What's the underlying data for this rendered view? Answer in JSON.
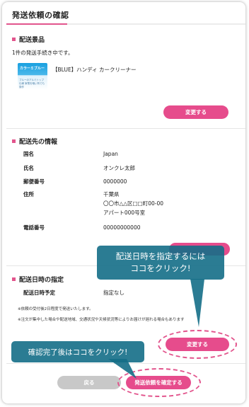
{
  "page": {
    "title": "発送依頼の確認"
  },
  "shipment": {
    "heading": "配送景品",
    "count_text": "1件の発送手続き中です。",
    "product_name": "【BLUE】ハンディ カークリーナー",
    "thumb_brand": "カラーミブルー",
    "thumb_caption": "ブルーのアルミトップ仕様 家電を暗い所でも操作",
    "change_label": "変更する"
  },
  "address": {
    "heading": "配送先の情報",
    "rows": [
      {
        "label": "国名",
        "value": "Japan"
      },
      {
        "label": "氏名",
        "value": "オンクレ太郎"
      },
      {
        "label": "郵便番号",
        "value": "0000000"
      },
      {
        "label": "住所",
        "value1": "千葉県",
        "value2": "〇〇市△△区□□町00-00",
        "value3": "アパート000号室"
      },
      {
        "label": "電話番号",
        "value": "00000000000"
      }
    ]
  },
  "delivery": {
    "heading": "配送日時の指定",
    "label": "配送日時予定",
    "value": "指定なし",
    "note1": "※依頼の受付後2日程度で発送いたします。",
    "note2": "※注文が集中した場合や配送地域、交通状況や天候状況等によりお届けが遅れる場合もあります",
    "change_label": "変更する"
  },
  "footer": {
    "back_label": "戻る",
    "confirm_label": "発送依頼を確定する"
  },
  "callouts": {
    "date_line1": "配送日時を指定するには",
    "date_line2": "ココをクリック!",
    "confirm_text": "確認完了後はココをクリック!"
  },
  "colors": {
    "accent": "#e2558d",
    "button": "#e64c8c",
    "callout": "#146e87",
    "back_button": "#c8c8c8"
  }
}
